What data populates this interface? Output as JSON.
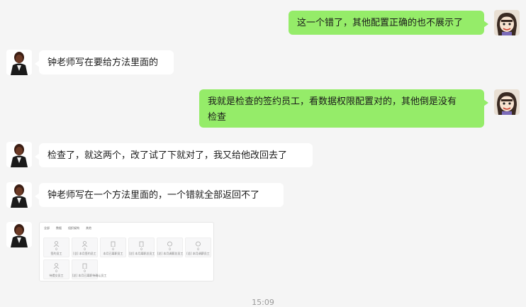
{
  "messages": [
    {
      "sender": "me",
      "text": "这一个错了，其他配置正确的也不展示了"
    },
    {
      "sender": "other",
      "text": "钟老师写在要给方法里面的"
    },
    {
      "sender": "me",
      "text_line1": "我就是检查的签约员工，看数据权限配置对的，其他倒是没有",
      "text_line2": "检查"
    },
    {
      "sender": "other",
      "text": "检查了，就这两个，改了试了下就对了，我又给他改回去了"
    },
    {
      "sender": "other",
      "text": "钟老师写在一个方法里面的，一个错就全部返回不了"
    }
  ],
  "image_message": {
    "tabs": [
      "全部",
      "数据",
      "组织架构",
      "其他"
    ],
    "cards": [
      {
        "icon": "person-icon",
        "num": "0",
        "label": "签约员工"
      },
      {
        "icon": "person-icon",
        "num": "0",
        "label": "[总] 本月签约员工"
      },
      {
        "icon": "building-icon",
        "num": "0",
        "label": "本月已离职员工"
      },
      {
        "icon": "building-icon",
        "num": "0",
        "label": "[总] 本月离职总员工"
      },
      {
        "icon": "refresh-icon",
        "num": "0",
        "label": "[总] 本月调薪总员工"
      },
      {
        "icon": "refresh-icon",
        "num": "0",
        "label": "[总] 本月调薪员工"
      },
      {
        "icon": "person-icon",
        "num": "0",
        "label": "待提交员工"
      },
      {
        "icon": "building-icon",
        "num": "0",
        "label": "[总] 本月已离职待确认员工"
      }
    ]
  },
  "timestamp": "15:09",
  "colors": {
    "my_bubble": "#95ec69",
    "other_bubble": "#ffffff",
    "background": "#f5f5f5"
  }
}
